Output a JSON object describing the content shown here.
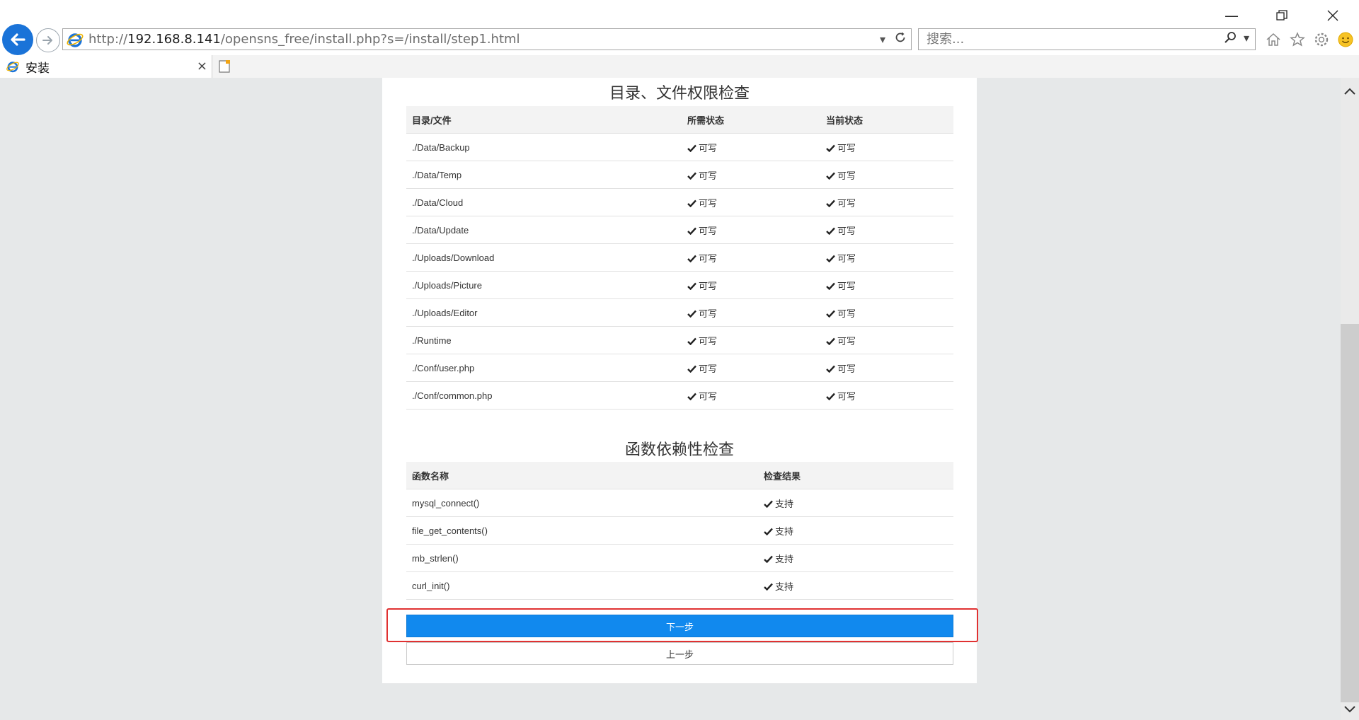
{
  "browser": {
    "url_prefix": "http://",
    "url_host": "192.168.8.141",
    "url_path": "/opensns_free/install.php?s=/install/step1.html",
    "search_placeholder": "搜索...",
    "tab_title": "安装",
    "tab_close": "×"
  },
  "dirs": {
    "title": "目录、文件权限检查",
    "headers": [
      "目录/文件",
      "所需状态",
      "当前状态"
    ],
    "rows": [
      {
        "path": "./Data/Backup",
        "required": "可写",
        "current": "可写"
      },
      {
        "path": "./Data/Temp",
        "required": "可写",
        "current": "可写"
      },
      {
        "path": "./Data/Cloud",
        "required": "可写",
        "current": "可写"
      },
      {
        "path": "./Data/Update",
        "required": "可写",
        "current": "可写"
      },
      {
        "path": "./Uploads/Download",
        "required": "可写",
        "current": "可写"
      },
      {
        "path": "./Uploads/Picture",
        "required": "可写",
        "current": "可写"
      },
      {
        "path": "./Uploads/Editor",
        "required": "可写",
        "current": "可写"
      },
      {
        "path": "./Runtime",
        "required": "可写",
        "current": "可写"
      },
      {
        "path": "./Conf/user.php",
        "required": "可写",
        "current": "可写"
      },
      {
        "path": "./Conf/common.php",
        "required": "可写",
        "current": "可写"
      }
    ]
  },
  "funcs": {
    "title": "函数依赖性检查",
    "headers": [
      "函数名称",
      "检查结果"
    ],
    "rows": [
      {
        "name": "mysql_connect()",
        "result": "支持"
      },
      {
        "name": "file_get_contents()",
        "result": "支持"
      },
      {
        "name": "mb_strlen()",
        "result": "支持"
      },
      {
        "name": "curl_init()",
        "result": "支持"
      }
    ]
  },
  "buttons": {
    "next": "下一步",
    "prev": "上一步"
  },
  "colors": {
    "primary": "#1189ee",
    "highlight": "#e03131",
    "ie_blue": "#1a73d8"
  }
}
